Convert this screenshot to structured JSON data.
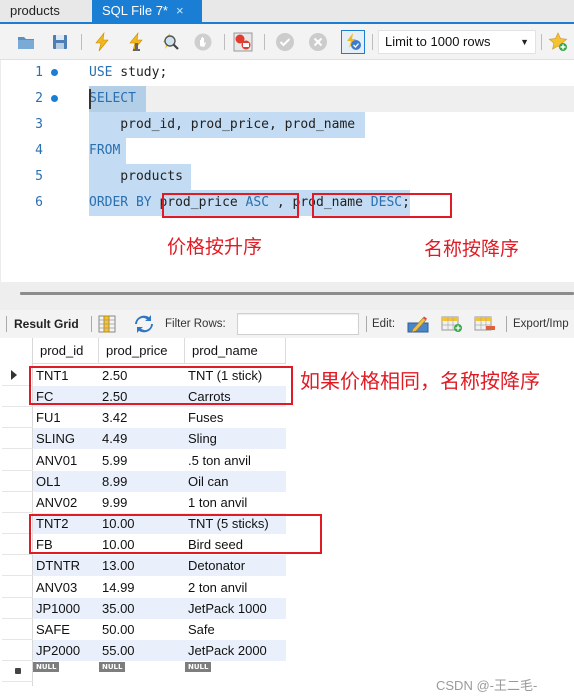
{
  "tabs": [
    {
      "label": "products",
      "active": false
    },
    {
      "label": "SQL File 7*",
      "active": true,
      "close_glyph": "×"
    }
  ],
  "toolbar": {
    "icons": [
      "open-folder-icon",
      "save-icon",
      "execute-icon",
      "execute-current-icon",
      "explain-icon",
      "stop-icon",
      "toggle-error-icon",
      "commit-icon",
      "rollback-icon",
      "autocommit-icon",
      "add-snippet-icon"
    ],
    "limit_select": {
      "value": "Limit to 1000 rows",
      "arrow": "▼"
    }
  },
  "editor": {
    "lines": [
      {
        "num": "1",
        "bullet": true,
        "tokens": [
          {
            "t": "USE",
            "k": "kw"
          },
          {
            "t": " study;",
            "k": "tx"
          }
        ]
      },
      {
        "num": "2",
        "bullet": true,
        "tokens": [
          {
            "t": "SELECT",
            "k": "kw"
          }
        ]
      },
      {
        "num": "3",
        "bullet": false,
        "tokens": [
          {
            "t": "    prod_id, prod_price, prod_name",
            "k": "tx"
          }
        ]
      },
      {
        "num": "4",
        "bullet": false,
        "tokens": [
          {
            "t": "FROM",
            "k": "kw"
          }
        ]
      },
      {
        "num": "5",
        "bullet": false,
        "tokens": [
          {
            "t": "    products",
            "k": "tx"
          }
        ]
      },
      {
        "num": "6",
        "bullet": false,
        "tokens": [
          {
            "t": "ORDER BY",
            "k": "kw"
          },
          {
            "t": " prod_price ",
            "k": "tx"
          },
          {
            "t": "ASC",
            "k": "kw"
          },
          {
            "t": " , ",
            "k": "tx"
          },
          {
            "t": "prod_name ",
            "k": "tx"
          },
          {
            "t": "DESC",
            "k": "kw"
          },
          {
            "t": ";",
            "k": "tx"
          }
        ]
      }
    ],
    "annotations": {
      "price_asc": "价格按升序",
      "name_desc": "名称按降序",
      "same_price": "如果价格相同，名称按降序"
    }
  },
  "result_toolbar": {
    "result_grid_label": "Result Grid",
    "filter_label": "Filter Rows:",
    "filter_value": "",
    "edit_label": "Edit:",
    "export_label": "Export/Imp"
  },
  "grid": {
    "columns": [
      "prod_id",
      "prod_price",
      "prod_name"
    ],
    "rows": [
      [
        "TNT1",
        "2.50",
        "TNT (1 stick)"
      ],
      [
        "FC",
        "2.50",
        "Carrots"
      ],
      [
        "FU1",
        "3.42",
        "Fuses"
      ],
      [
        "SLING",
        "4.49",
        "Sling"
      ],
      [
        "ANV01",
        "5.99",
        ".5 ton anvil"
      ],
      [
        "OL1",
        "8.99",
        "Oil can"
      ],
      [
        "ANV02",
        "9.99",
        "1 ton anvil"
      ],
      [
        "TNT2",
        "10.00",
        "TNT (5 sticks)"
      ],
      [
        "FB",
        "10.00",
        "Bird seed"
      ],
      [
        "DTNTR",
        "13.00",
        "Detonator"
      ],
      [
        "ANV03",
        "14.99",
        "2 ton anvil"
      ],
      [
        "JP1000",
        "35.00",
        "JetPack 1000"
      ],
      [
        "SAFE",
        "50.00",
        "Safe"
      ],
      [
        "JP2000",
        "55.00",
        "JetPack 2000"
      ]
    ],
    "null_label": "NULL"
  },
  "watermark": "CSDN @-王二毛-",
  "colors": {
    "accent": "#1a7fd4",
    "annotation_red": "#e01b24",
    "selection": "#c3dcf3",
    "keyword": "#2a6fb0",
    "row_alt": "#e9f0fb"
  }
}
